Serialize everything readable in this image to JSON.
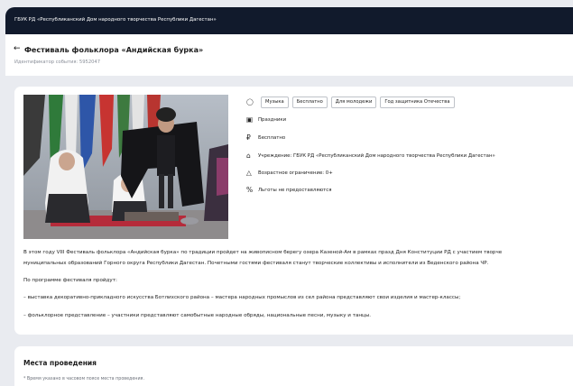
{
  "topbar": {
    "org_name": "ГБУК РД «Республиканский Дом народного творчества Республики Дагестан»"
  },
  "header": {
    "back_icon": "arrow-left-icon",
    "title": "Фестиваль фольклора «Андийская бурка»",
    "event_id": "Идентификатор события: 5952047"
  },
  "event": {
    "tags": [
      "Музыка",
      "Бесплатно",
      "Для молодежи",
      "Год защитника Отечества"
    ],
    "details": [
      {
        "icon": "folder-icon",
        "text": "Праздники"
      },
      {
        "icon": "ruble-icon",
        "text": "Бесплатно"
      },
      {
        "icon": "institution-icon",
        "text": "Учреждение: ГБУК РД «Республиканский Дом народного творчества Республики Дагестан»"
      },
      {
        "icon": "warning-icon",
        "text": "Возрастное ограничение: 0+"
      },
      {
        "icon": "percent-icon",
        "text": "Льготы не предоставляются"
      }
    ],
    "description": [
      "В этом году VIII Фестиваль фольклора «Андийская бурка» по традиции пройдет на живописном берегу озера Казеной-Ам в рамках празд Дня Конституции РД с участием творче",
      "муниципальных образований Горного округа Республики Дагестан. Почетными гостями фестиваля станут творческие коллективы и исполнители из Веденского района ЧР.",
      "По программе фестиваля пройдут:",
      "– выставка декоративно-прикладного искусства Ботлихского района – мастера народных промыслов из сел района представляют свои изделия и мастер-классы;",
      "– фольклорное представление – участники представляют самобытные народные обряды, национальные песни, музыку и танцы."
    ]
  },
  "venues": {
    "title": "Места проведения",
    "note": "* Время указано в часовом поясе места проведения."
  }
}
